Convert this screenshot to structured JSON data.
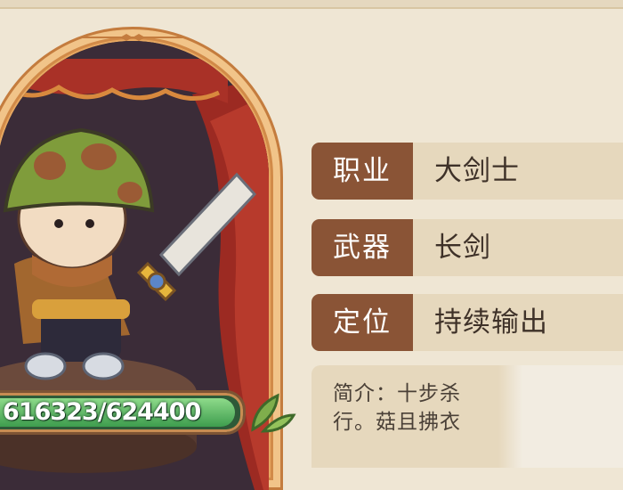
{
  "hero": {
    "name_icon": "mushroom-swordsman-portrait",
    "hp_current": 616323,
    "hp_max": 624400,
    "hp_text": "616323/624400"
  },
  "info": {
    "class_label": "职业",
    "class_value": "大剑士",
    "weapon_label": "武器",
    "weapon_value": "长剑",
    "role_label": "定位",
    "role_value": "持续输出"
  },
  "description": {
    "line1": "简介：十步杀",
    "line2": "行。菇且拂衣"
  },
  "colors": {
    "label_bg": "#8a5436",
    "row_bg": "#e6d8bd",
    "frame": "#e7a861",
    "hp_green": "#3e9d4e"
  }
}
